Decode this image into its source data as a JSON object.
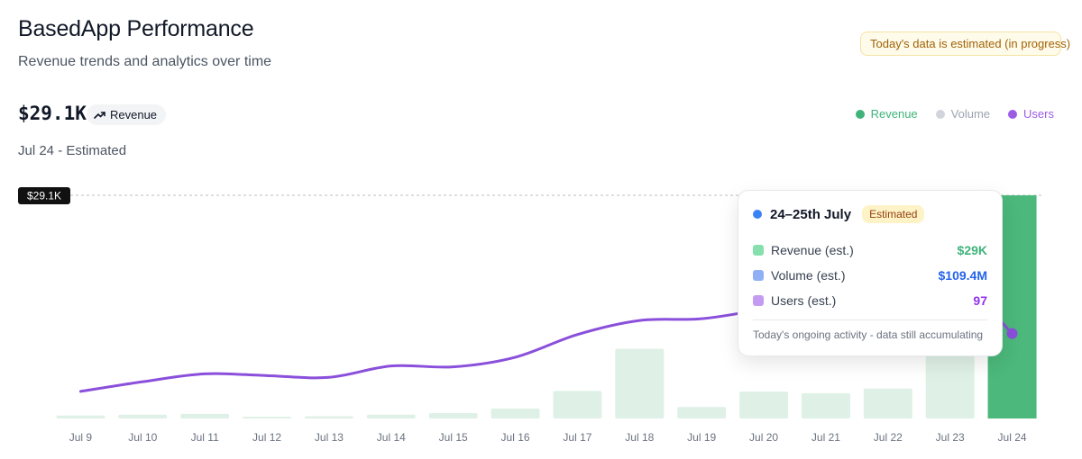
{
  "header": {
    "title": "BasedApp Performance",
    "subtitle": "Revenue trends and analytics over time",
    "notice": "Today's data is estimated (in progress)"
  },
  "summary": {
    "value": "$29.1K",
    "metric_label": "Revenue",
    "date_label": "Jul 24 - Estimated"
  },
  "legend": [
    {
      "name": "Revenue",
      "color": "#3fb37a",
      "active": true
    },
    {
      "name": "Volume",
      "color": "#d1d5db",
      "active": false
    },
    {
      "name": "Users",
      "color": "#9b5de5",
      "active": true
    }
  ],
  "tooltip": {
    "date": "24–25th July",
    "badge": "Estimated",
    "rows": [
      {
        "label": "Revenue (est.)",
        "value": "$29K",
        "color": "#3fb37a",
        "swatch": "#86e0ad"
      },
      {
        "label": "Volume (est.)",
        "value": "$109.4M",
        "color": "#2563eb",
        "swatch": "#8fb0f5"
      },
      {
        "label": "Users (est.)",
        "value": "97",
        "color": "#9333ea",
        "swatch": "#c49bf2"
      }
    ],
    "footer": "Today's ongoing activity - data still accumulating"
  },
  "chart_data": {
    "type": "bar",
    "categories": [
      "Jul 9",
      "Jul 10",
      "Jul 11",
      "Jul 12",
      "Jul 13",
      "Jul 14",
      "Jul 15",
      "Jul 16",
      "Jul 17",
      "Jul 18",
      "Jul 19",
      "Jul 20",
      "Jul 21",
      "Jul 22",
      "Jul 23",
      "Jul 24"
    ],
    "series": [
      {
        "name": "Revenue",
        "chart": "bar",
        "values": [
          0.4,
          0.5,
          0.6,
          0.1,
          0.3,
          0.5,
          0.7,
          1.3,
          3.6,
          9.1,
          1.5,
          3.5,
          3.3,
          3.9,
          11.0,
          29.1
        ],
        "highlight_index": 15
      },
      {
        "name": "Users",
        "chart": "line",
        "values": [
          31,
          42,
          51,
          49,
          47,
          60,
          59,
          70,
          96,
          112,
          114,
          125,
          138,
          152,
          165,
          97
        ],
        "max": 255
      }
    ],
    "reference_line": {
      "value": 29.1,
      "label": "$29.1K"
    },
    "ylim": [
      0,
      29.1
    ],
    "grid": false,
    "colors": {
      "bar": "#dff1e6",
      "bar_highlight": "#4cb87b",
      "line": "#8a4fdb"
    }
  }
}
